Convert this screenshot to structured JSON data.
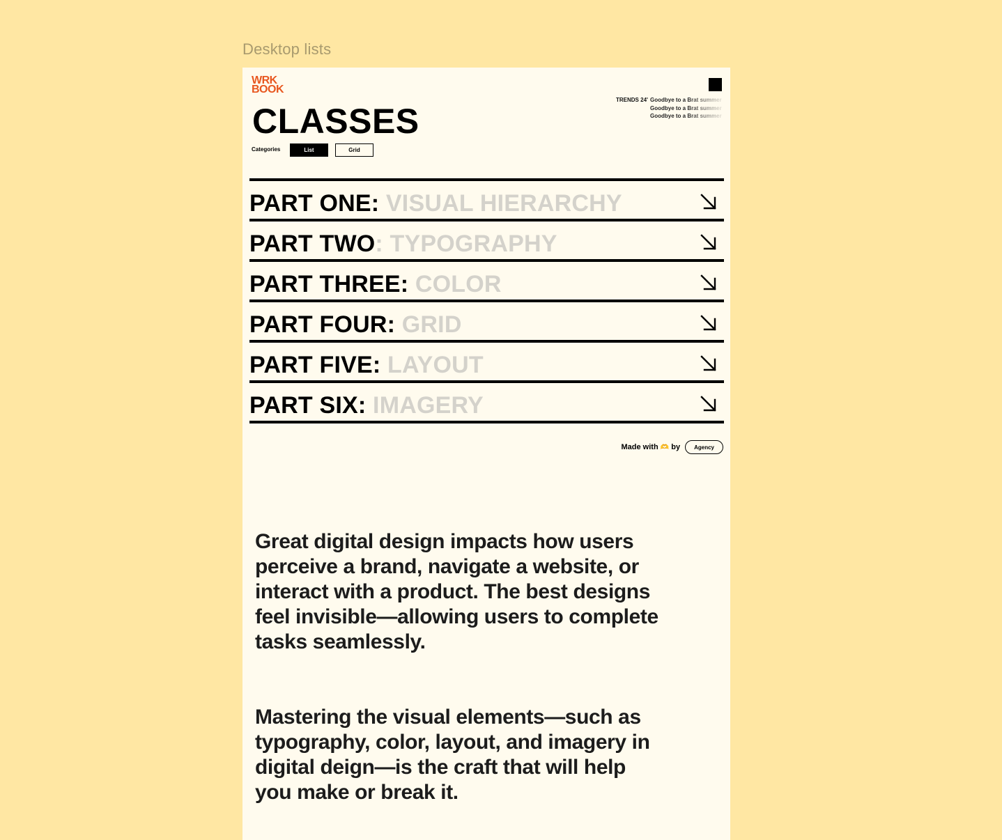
{
  "canvas": {
    "frame_label": "Desktop lists"
  },
  "colors": {
    "background": "#FFE7A3",
    "frame": "#FFFBEE",
    "brand": "#E8571F",
    "ink": "#000000",
    "muted_topic": "#D4D2CB"
  },
  "header": {
    "logo_line1": "WRK",
    "logo_line2": "BOOK",
    "menu_icon": "square-menu-icon",
    "trends": {
      "label": "TRENDS 24'",
      "items": [
        "Goodbye to a Brat summer",
        "Goodbye to a Brat summer",
        "Goodbye to a Brat summer"
      ]
    },
    "title": "CLASSES",
    "categories_label": "Categories",
    "view_buttons": {
      "list": "List",
      "grid": "Grid",
      "selected": "List"
    }
  },
  "classes": [
    {
      "part": "PART ONE:",
      "topic": " VISUAL HIERARCHY",
      "icon": "arrow-down-right-icon"
    },
    {
      "part": "PART TWO",
      "topic": ": TYPOGRAPHY",
      "icon": "arrow-down-right-icon"
    },
    {
      "part": "PART THREE:",
      "topic": " COLOR",
      "icon": "arrow-down-right-icon"
    },
    {
      "part": "PART FOUR:",
      "topic": " GRID",
      "icon": "arrow-down-right-icon"
    },
    {
      "part": "PART FIVE:",
      "topic": " LAYOUT",
      "icon": "arrow-down-right-icon"
    },
    {
      "part": "PART SIX:",
      "topic": " IMAGERY",
      "icon": "arrow-down-right-icon"
    }
  ],
  "footer": {
    "made_with": "Made with",
    "heart": "🫶",
    "by": "by",
    "agency": "Agency"
  },
  "body_text": {
    "paragraph1": "Great digital design impacts how users perceive a brand, navigate a website, or interact with a product. The best designs feel invisible—allowing users to complete tasks seamlessly.",
    "paragraph2": "Mastering the visual elements—such as typography, color, layout, and imagery in digital deign—is the craft that will help you make or break it."
  }
}
